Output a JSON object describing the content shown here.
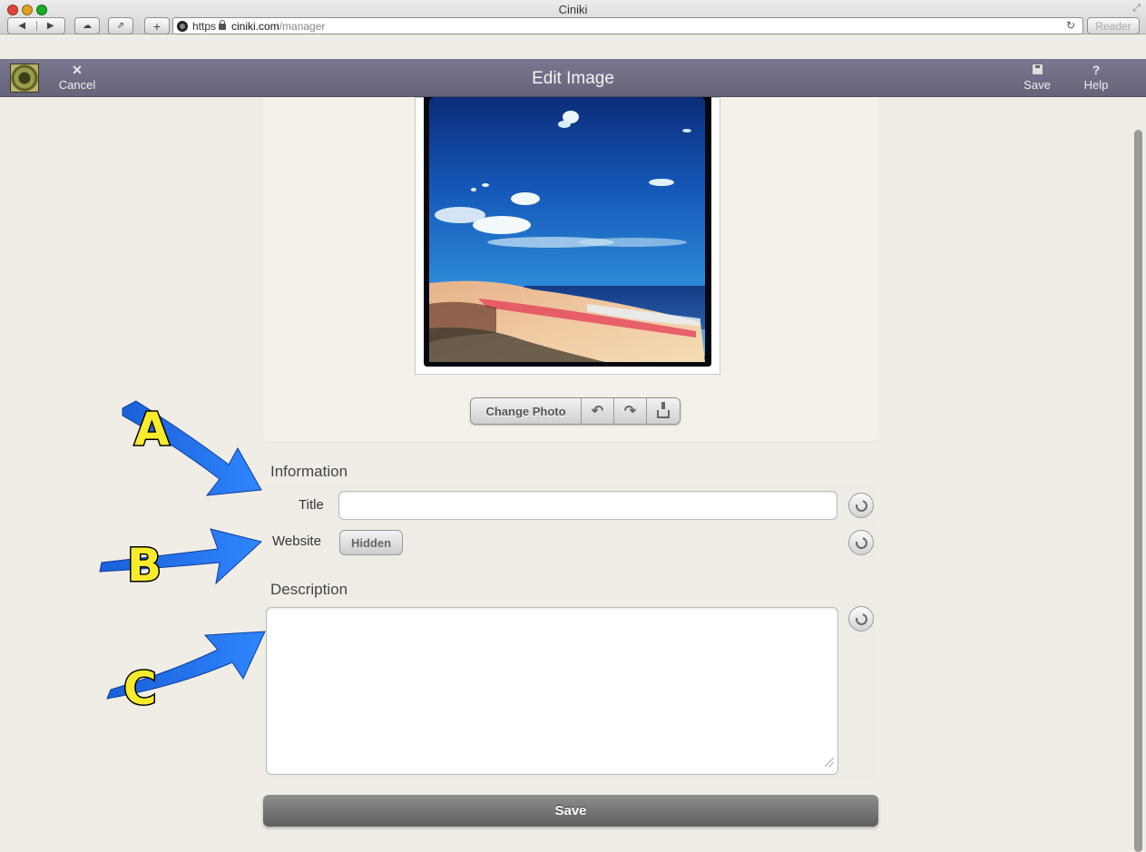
{
  "browser": {
    "window_title": "Ciniki",
    "url_scheme": "https",
    "url_domain": "ciniki.com",
    "url_path": "/manager",
    "reader_label": "Reader"
  },
  "header": {
    "cancel_label": "Cancel",
    "title": "Edit Image",
    "save_label": "Save",
    "help_label": "Help"
  },
  "photo": {
    "change_photo_label": "Change Photo"
  },
  "information": {
    "section_label": "Information",
    "title_label": "Title",
    "title_value": "",
    "website_label": "Website",
    "website_visibility": "Hidden"
  },
  "description": {
    "section_label": "Description",
    "value": ""
  },
  "footer": {
    "save_label": "Save"
  },
  "annotations": {
    "a": "A",
    "b": "B",
    "c": "C",
    "arrow_color": "#1f6ff0",
    "letter_color": "#f7ec2c"
  }
}
